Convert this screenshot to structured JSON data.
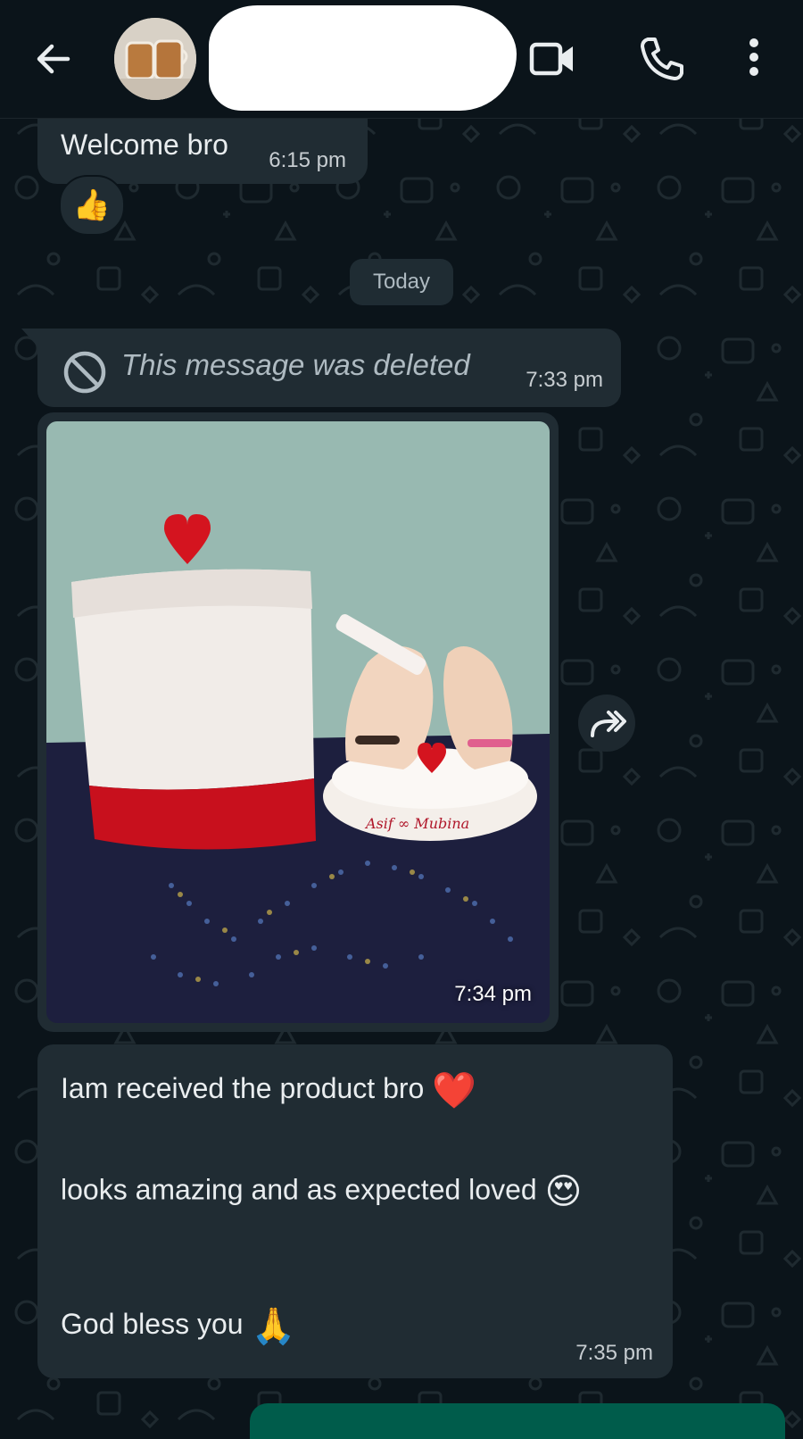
{
  "header": {
    "contact_name": "",
    "back_icon": "arrow-left-icon",
    "video_icon": "video-camera-icon",
    "call_icon": "phone-icon",
    "menu_icon": "more-vertical-icon"
  },
  "messages": [
    {
      "text": "Welcome bro",
      "time": "6:15 pm",
      "reaction": "👍"
    },
    {
      "date_separator": "Today"
    },
    {
      "text": "This message was deleted",
      "time": "7:33 pm",
      "deleted": true
    },
    {
      "type": "image",
      "time": "7:34 pm",
      "image_caption_names": "Asif ∞ Mubina"
    },
    {
      "line1": "Iam received the product bro",
      "emoji1": "❤️",
      "line2": "looks amazing and as expected loved",
      "emoji2": "😍",
      "line3": "God bless you",
      "emoji3": "🙏",
      "time": "7:35 pm"
    }
  ],
  "colors": {
    "background": "#0b141a",
    "incoming_bubble": "#202c33",
    "outgoing_bubble": "#005c4b",
    "text": "#e9edef",
    "meta_text": "#c7cdd1"
  }
}
